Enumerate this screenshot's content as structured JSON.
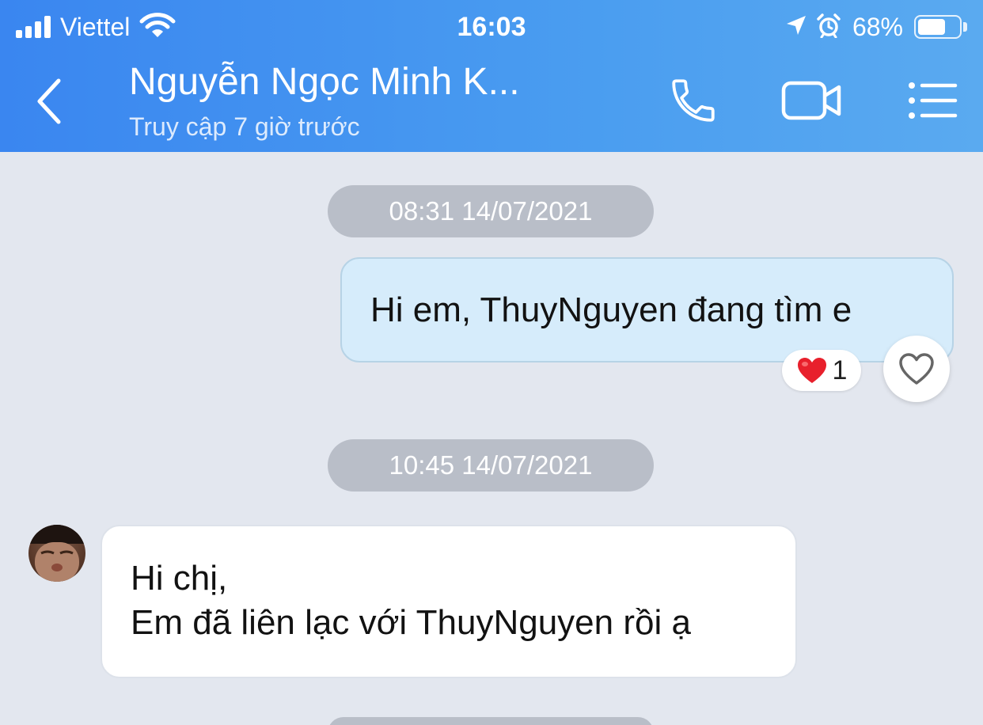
{
  "status_bar": {
    "carrier": "Viettel",
    "time": "16:03",
    "battery_percent": "68%",
    "battery_level": 0.68,
    "icons": [
      "signal-icon",
      "wifi-icon",
      "location-arrow-icon",
      "alarm-icon",
      "battery-icon"
    ]
  },
  "header": {
    "contact_name": "Nguyễn Ngọc Minh K...",
    "contact_status": "Truy cập 7 giờ trước",
    "icons": [
      "back-chevron-icon",
      "phone-icon",
      "video-camera-icon",
      "menu-list-icon"
    ]
  },
  "chat": {
    "timestamps": [
      "08:31 14/07/2021",
      "10:45 14/07/2021"
    ],
    "messages": [
      {
        "direction": "outgoing",
        "lines": [
          "Hi em, ThuyNguyen đang tìm e"
        ],
        "reaction": {
          "emoji": "❤️",
          "count": "1"
        }
      },
      {
        "direction": "incoming",
        "lines": [
          "Hi chị,",
          "Em đã liên lạc với ThuyNguyen rồi ạ"
        ]
      }
    ]
  },
  "colors": {
    "header_gradient_start": "#3a86f0",
    "header_gradient_end": "#5aaaf0",
    "background": "#e3e7ef",
    "outgoing_bubble": "#d6ecfb",
    "incoming_bubble": "#ffffff",
    "timestamp_pill": "#b9bec8",
    "reaction_heart": "#e8202c"
  }
}
